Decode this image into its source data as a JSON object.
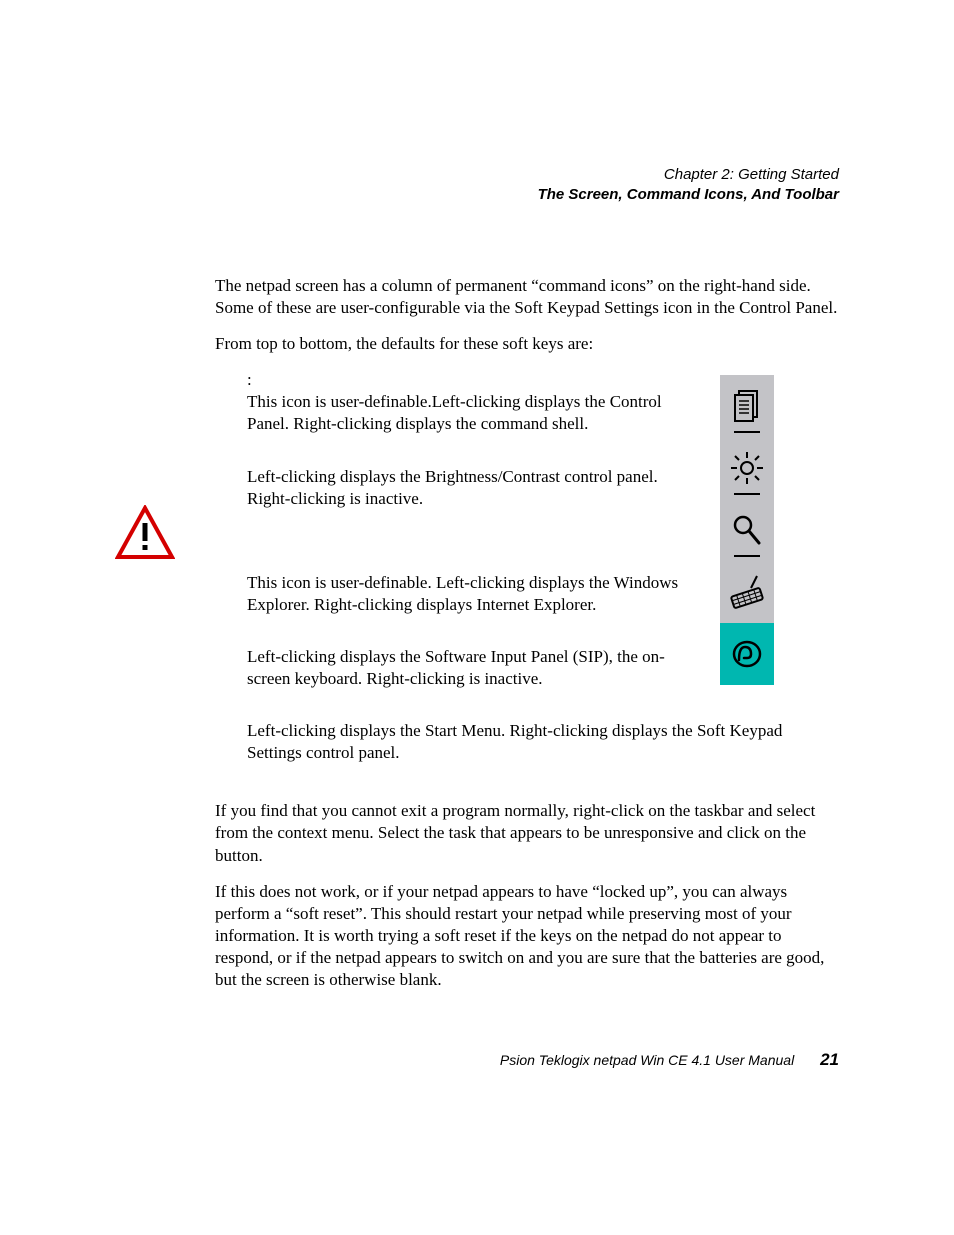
{
  "header": {
    "chapter": "Chapter 2:  Getting Started",
    "section": "The Screen, Command Icons, And Toolbar"
  },
  "intro": {
    "p1": "The netpad screen has a column of permanent “command icons” on the right-hand side. Some of these are user-configurable via the Soft Keypad Settings icon in the Control Panel.",
    "p2": "From top to bottom, the defaults for these soft keys are:"
  },
  "softkeys": [
    {
      "label": "",
      "colon": ":",
      "text": "This icon is user-definable.Left-clicking displays the Control Panel. Right-clicking displays the command shell."
    },
    {
      "label": "",
      "colon": "",
      "text": "Left-clicking displays the Brightness/Contrast control panel. Right-clicking is inactive."
    },
    {
      "label": "",
      "colon": "",
      "text": "This icon is user-definable. Left-clicking displays the Windows Explorer. Right-clicking displays Internet Explorer."
    },
    {
      "label": "",
      "colon": "",
      "text": "Left-clicking displays the Software Input Panel (SIP), the on-screen keyboard. Right-clicking is inactive."
    },
    {
      "label": "",
      "colon": "",
      "text": "Left-clicking displays the Start Menu. Right-clicking displays the Soft Keypad Settings control panel."
    }
  ],
  "trouble": {
    "p1a": "If you find that you cannot exit a program normally, right-click on the taskbar and select ",
    "menu_item": "",
    "p1b": " from the context menu. Select the task that appears to be unresponsive and click on the ",
    "button_label": "",
    "p1c": " button.",
    "p2": "If this does not work, or if your netpad appears to have “locked up”, you can always perform a “soft reset”. This should restart your netpad while preserving most of your information. It is worth trying a soft reset if the keys on the netpad do not appear to respond, or if the netpad appears to switch on and you are sure that the batteries are good, but the screen is otherwise blank."
  },
  "footer": {
    "title": "Psion Teklogix netpad Win CE 4.1 User Manual",
    "page": "21"
  }
}
